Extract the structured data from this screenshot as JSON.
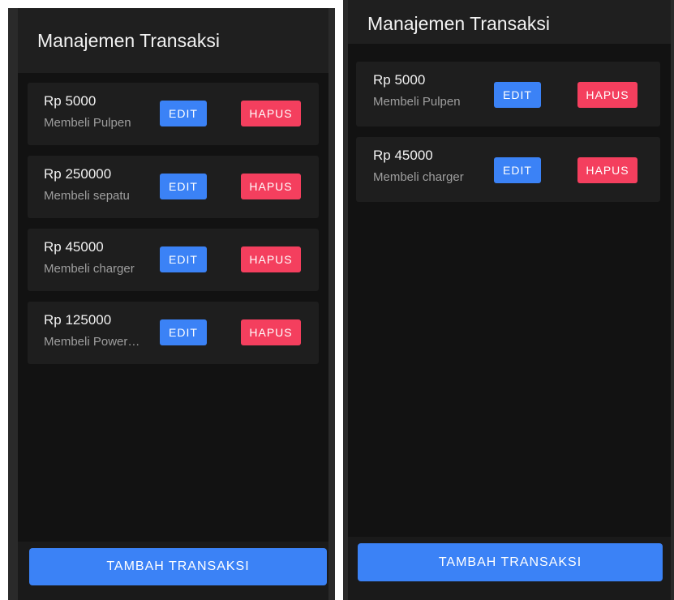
{
  "screens": [
    {
      "header": {
        "title": "Manajemen Transaksi"
      },
      "transactions": [
        {
          "amount": "Rp 5000",
          "description": "Membeli Pulpen",
          "edit_label": "EDIT",
          "delete_label": "HAPUS"
        },
        {
          "amount": "Rp 250000",
          "description": "Membeli sepatu",
          "edit_label": "EDIT",
          "delete_label": "HAPUS"
        },
        {
          "amount": "Rp 45000",
          "description": "Membeli charger",
          "edit_label": "EDIT",
          "delete_label": "HAPUS"
        },
        {
          "amount": "Rp 125000",
          "description": "Membeli Power…",
          "edit_label": "EDIT",
          "delete_label": "HAPUS"
        }
      ],
      "add_button_label": "TAMBAH TRANSAKSI"
    },
    {
      "header": {
        "title": "Manajemen Transaksi"
      },
      "transactions": [
        {
          "amount": "Rp 5000",
          "description": "Membeli Pulpen",
          "edit_label": "EDIT",
          "delete_label": "HAPUS"
        },
        {
          "amount": "Rp 45000",
          "description": "Membeli charger",
          "edit_label": "EDIT",
          "delete_label": "HAPUS"
        }
      ],
      "add_button_label": "TAMBAH TRANSAKSI"
    }
  ],
  "colors": {
    "background": "#121212",
    "header": "#1f1f1f",
    "card": "#1e1e1e",
    "edit_button": "#3b82f6",
    "delete_button": "#f43f5e",
    "add_button": "#3b82f6"
  }
}
